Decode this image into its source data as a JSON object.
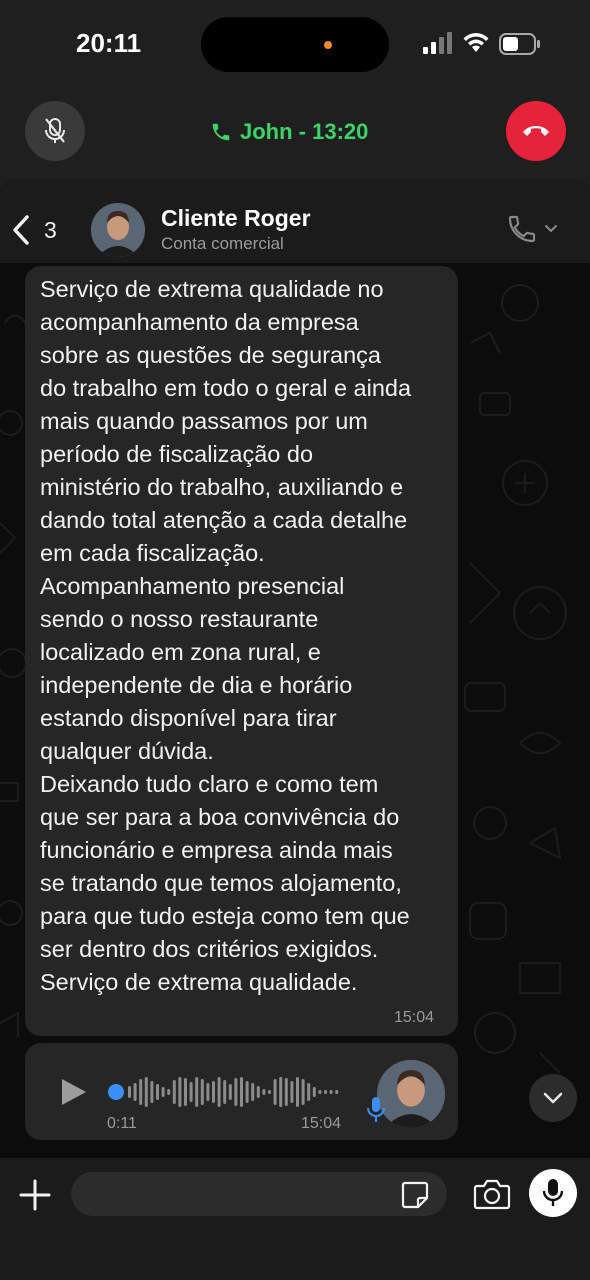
{
  "status_bar": {
    "time": "20:11",
    "icons": [
      "signal-icon",
      "wifi-icon",
      "battery-icon"
    ]
  },
  "call_bar": {
    "call_label": "John - 13:20",
    "accent_color": "#3cd46a",
    "hangup_color": "#e5243b",
    "icons": [
      "mute-icon",
      "phone-icon",
      "hangup-icon"
    ]
  },
  "chat_header": {
    "back_count": "3",
    "contact_name": "Cliente Roger",
    "contact_subtitle": "Conta comercial",
    "icons": [
      "back-chevron-icon",
      "phone-icon",
      "chevron-down-icon"
    ]
  },
  "messages": [
    {
      "type": "text",
      "text": "Serviço de extrema qualidade no\nacompanhamento da empresa\nsobre as questões de segurança\ndo trabalho em todo o geral e ainda\nmais quando passamos por um\nperíodo de fiscalização do\nministério do trabalho, auxiliando e\ndando total atenção a cada detalhe\nem cada fiscalização.\nAcompanhamento presencial\nsendo o nosso restaurante\nlocalizado em zona rural, e\nindependente de dia e horário\nestando disponível para tirar\nqualquer dúvida.\nDeixando tudo claro e como tem\nque ser para a boa convivência do\nfuncionário e empresa ainda mais\nse tratando que temos alojamento,\npara que tudo esteja como tem que\nser dentro dos critérios exigidos.\nServiço de extrema qualidade.",
      "time": "15:04"
    },
    {
      "type": "audio",
      "duration": "0:11",
      "time": "15:04",
      "progress": 0,
      "icons": [
        "play-icon",
        "microphone-icon"
      ]
    }
  ],
  "input_bar": {
    "placeholder": "",
    "icons": [
      "plus-icon",
      "sticker-icon",
      "camera-icon",
      "microphone-icon"
    ]
  },
  "colors": {
    "bubble": "#262626",
    "background": "#0c0c0c",
    "audio_dot": "#3a8ff6"
  }
}
